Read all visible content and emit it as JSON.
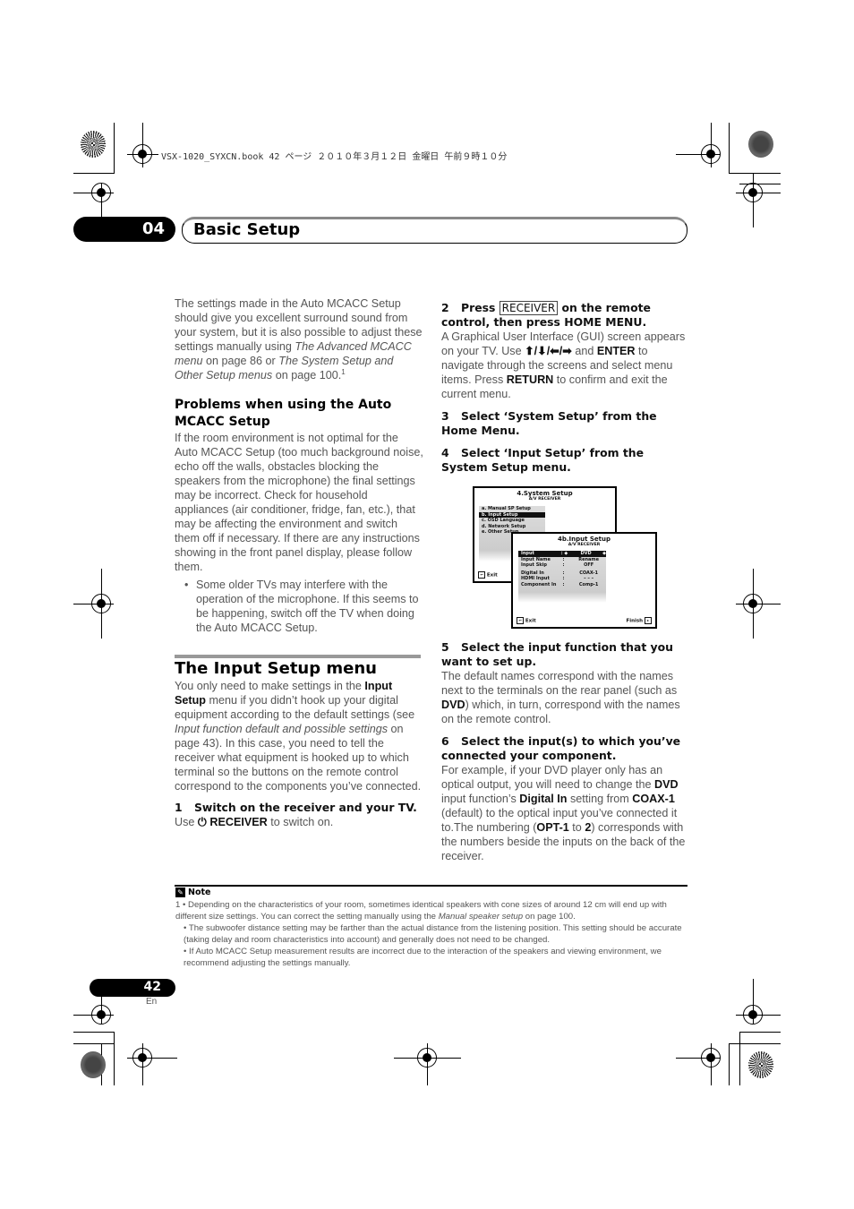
{
  "print_header": "VSX-1020_SYXCN.book  42 ページ  ２０１０年３月１２日  金曜日  午前９時１０分",
  "chapter": {
    "number": "04",
    "title": "Basic Setup"
  },
  "left_column": {
    "intro": {
      "t1": "The settings made in the Auto MCACC Setup should give you excellent surround sound from your system, but it is also possible to adjust these settings manually using ",
      "i1": "The Advanced MCACC menu",
      "t2": " on page 86 or ",
      "i2": "The System Setup and Other Setup menus",
      "t3": " on page 100.",
      "footnote_ref": "1"
    },
    "problems_heading": "Problems when using the Auto MCACC Setup",
    "problems_text": "If the room environment is not optimal for the Auto MCACC Setup (too much background noise, echo off the walls, obstacles blocking the speakers from the microphone) the final settings may be incorrect. Check for household appliances (air conditioner, fridge, fan, etc.), that may be affecting the environment and switch them off if necessary. If there are any instructions showing in the front panel display, please follow them.",
    "problems_bullet": "Some older TVs may interfere with the operation of the microphone. If this seems to be happening, switch off the TV when doing the Auto MCACC Setup.",
    "input_setup_heading": "The Input Setup menu",
    "input_setup_text": {
      "t1": "You only need to make settings in the ",
      "b1": "Input Setup",
      "t2": " menu if you didn’t hook up your digital equipment according to the default settings (see ",
      "i1": "Input function default and possible settings",
      "t3": " on page 43). In this case, you need to tell the receiver what equipment is hooked up to which terminal so the buttons on the remote control correspond to the components you’ve connected."
    },
    "step1": {
      "num": "1",
      "title": "Switch on the receiver and your TV.",
      "t1": "Use ",
      "power_icon": "⏻",
      "b1": "RECEIVER",
      "t2": " to switch on."
    }
  },
  "right_column": {
    "step2": {
      "num": "2",
      "t1": "Press ",
      "key": "RECEIVER",
      "t2": " on the remote control, then press HOME MENU.",
      "body_t1": "A Graphical User Interface (GUI) screen appears on your TV. Use ",
      "arrows": "⬆/⬇/⬅/➡",
      "body_t2": " and ",
      "b1": "ENTER",
      "body_t3": " to navigate through the screens and select menu items. Press ",
      "b2": "RETURN",
      "body_t4": " to confirm and exit the current menu."
    },
    "step3": {
      "num": "3",
      "title": "Select ‘System Setup’ from the Home Menu."
    },
    "step4": {
      "num": "4",
      "title": "Select ‘Input Setup’ from the System Setup menu."
    },
    "gui": {
      "system_setup": {
        "title": "4.System Setup",
        "subtitle": "A/V RECEIVER",
        "items": [
          "a. Manual SP Setup",
          "b. Input Setup",
          "c. OSD Language",
          "d. Network Setup",
          "e. Other Setup"
        ],
        "selected_index": 1,
        "exit": "Exit"
      },
      "input_setup": {
        "title": "4b.Input Setup",
        "subtitle": "A/V RECEIVER",
        "rows": [
          {
            "key": "Input",
            "value": "DVD"
          },
          {
            "key": "Input Name",
            "value": "Rename"
          },
          {
            "key": "Input Skip",
            "value": "OFF"
          },
          {
            "key": "Digital In",
            "value": "COAX-1"
          },
          {
            "key": "HDMI Input",
            "value": "– – –"
          },
          {
            "key": "Component In",
            "value": "Comp-1"
          }
        ],
        "exit": "Exit",
        "finish": "Finish"
      }
    },
    "step5": {
      "num": "5",
      "title": "Select the input function that you want to set up.",
      "t1": "The default names correspond with the names next to the terminals on the rear panel (such as ",
      "b1": "DVD",
      "t2": ") which, in turn, correspond with the names on the remote control."
    },
    "step6": {
      "num": "6",
      "title": "Select the input(s) to which you’ve connected your component.",
      "t1": "For example, if your DVD player only has an optical output, you will need to change the ",
      "b1": "DVD",
      "t2": " input function’s ",
      "b2": "Digital In",
      "t3": " setting from ",
      "b3": "COAX-1",
      "t4": " (default) to the optical input you’ve connected it to.The numbering (",
      "b4": "OPT-1",
      "t5": " to ",
      "b5": "2",
      "t6": ") corresponds with the numbers beside the inputs on the back of the receiver."
    }
  },
  "note": {
    "heading": "Note",
    "num": "1",
    "n1_t1": "• Depending on the characteristics of your room, sometimes identical speakers with cone sizes of around 12 cm will end up with different size settings. You can correct the setting manually using the ",
    "n1_i": "Manual speaker setup",
    "n1_t2": " on page 100.",
    "n2": "• The subwoofer distance setting may be farther than the actual distance from the listening position. This setting should be accurate (taking delay and room characteristics into account) and generally does not need to be changed.",
    "n3": "• If Auto MCACC Setup measurement results are incorrect due to the interaction of the speakers and viewing environment, we recommend adjusting the settings manually."
  },
  "footer": {
    "page_number": "42",
    "language": "En"
  }
}
